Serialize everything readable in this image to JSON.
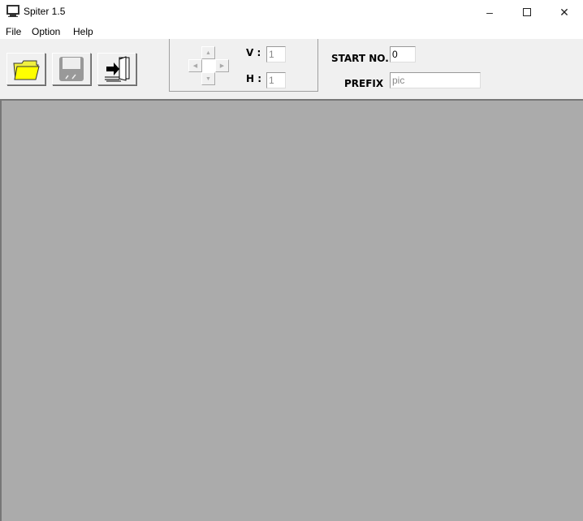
{
  "window": {
    "title": "Spiter 1.5",
    "minimize_icon": "minimize",
    "maximize_icon": "maximize",
    "close_icon": "close"
  },
  "menu": [
    "File",
    "Option",
    "Help"
  ],
  "toolbar": {
    "open_icon": "folder-icon",
    "save_icon": "floppy-icon",
    "exit_icon": "exit-door-icon"
  },
  "split": {
    "v_label": "V :",
    "v_value": "1",
    "h_label": "H :",
    "h_value": "1"
  },
  "naming": {
    "start_label": "START NO.",
    "start_value": "0",
    "prefix_label": "PREFIX",
    "prefix_value": "pic"
  }
}
